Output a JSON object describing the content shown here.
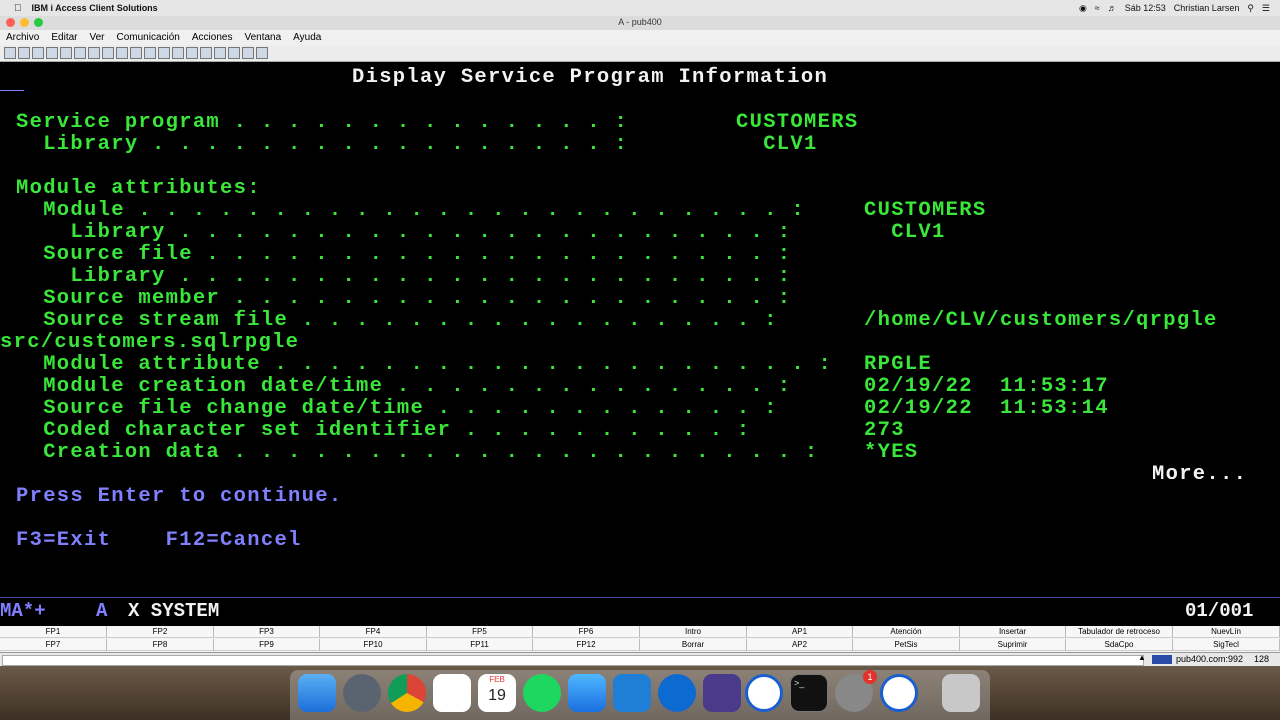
{
  "mac_menubar": {
    "app_name": "IBM i Access Client Solutions",
    "clock": "Sáb 12:53",
    "user": "Christian Larsen"
  },
  "window": {
    "title": "A - pub400"
  },
  "app_menu": [
    "Archivo",
    "Editar",
    "Ver",
    "Comunicación",
    "Acciones",
    "Ventana",
    "Ayuda"
  ],
  "terminal": {
    "heading": "Display Service Program Information",
    "rows": [
      {
        "label": "Service program",
        "dots": " . . . . . . . . . . . . . . :",
        "value": "CUSTOMERS"
      },
      {
        "label": "  Library",
        "dots": " . . . . . . . . . . . . . . . . . :",
        "value": "  CLV1"
      },
      {
        "label": "Module attributes:",
        "dots": "",
        "value": ""
      },
      {
        "label": "  Module",
        "dots": " . . . . . . . . . . . . . . . . . . . . . . . . :",
        "value": "CUSTOMERS"
      },
      {
        "label": "    Library",
        "dots": " . . . . . . . . . . . . . . . . . . . . . . :",
        "value": "  CLV1"
      },
      {
        "label": "  Source file",
        "dots": " . . . . . . . . . . . . . . . . . . . . . :",
        "value": ""
      },
      {
        "label": "    Library",
        "dots": " . . . . . . . . . . . . . . . . . . . . . . :",
        "value": ""
      },
      {
        "label": "  Source member",
        "dots": " . . . . . . . . . . . . . . . . . . . . :",
        "value": ""
      },
      {
        "label": "  Source stream file",
        "dots": " . . . . . . . . . . . . . . . . . :",
        "value": "/home/CLV/customers/qrpgle"
      },
      {
        "label": "src/customers.sqlrpgle",
        "dots": "",
        "value": ""
      },
      {
        "label": "  Module attribute",
        "dots": " . . . . . . . . . . . . . . . . . . . . :",
        "value": "RPGLE"
      },
      {
        "label": "  Module creation date/time",
        "dots": " . . . . . . . . . . . . . . :",
        "value": "02/19/22  11:53:17"
      },
      {
        "label": "  Source file change date/time",
        "dots": " . . . . . . . . . . . . :",
        "value": "02/19/22  11:53:14"
      },
      {
        "label": "  Coded character set identifier",
        "dots": " . . . . . . . . . . :",
        "value": "273"
      },
      {
        "label": "  Creation data",
        "dots": " . . . . . . . . . . . . . . . . . . . . . :",
        "value": "*YES"
      }
    ],
    "more": "More...",
    "prompt": "Press Enter to continue.",
    "fkeys_line": "F3=Exit    F12=Cancel"
  },
  "status_line": {
    "left": "MA*+",
    "a": "A",
    "x": "X SYSTEM",
    "cursor": "01/001"
  },
  "fkey_buttons": {
    "row1": [
      "FP1",
      "FP2",
      "FP3",
      "FP4",
      "FP5",
      "FP6",
      "Intro",
      "AP1",
      "Atención",
      "Insertar",
      "Tabulador de retroceso",
      "NuevLín"
    ],
    "row2": [
      "FP7",
      "FP8",
      "FP9",
      "FP10",
      "FP11",
      "FP12",
      "Borrar",
      "AP2",
      "PetSis",
      "Suprimir",
      "SdaCpo",
      "SigTecl"
    ]
  },
  "info_bar": {
    "host": "pub400.com:992",
    "bits": "128"
  },
  "dock": {
    "calendar_month": "FEB",
    "calendar_day": "19",
    "badge": "1"
  },
  "colors": {
    "terminal_green": "#39e639",
    "terminal_blue": "#8080ff",
    "terminal_white": "#f2f2f2"
  }
}
